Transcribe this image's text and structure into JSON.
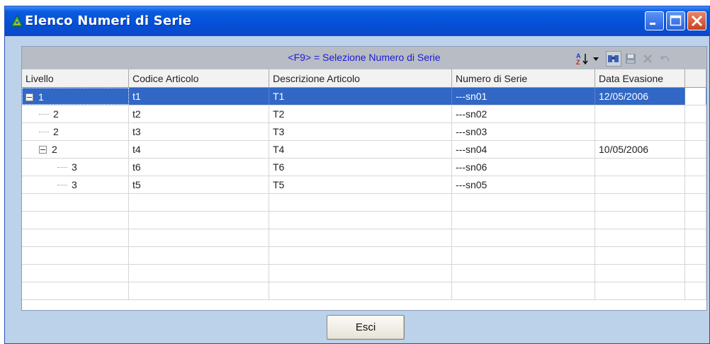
{
  "window": {
    "title": "Elenco Numeri di Serie"
  },
  "grid": {
    "caption": "<F9> = Selezione Numero di Serie",
    "columns": [
      "Livello",
      "Codice Articolo",
      "Descrizione Articolo",
      "Numero di Serie",
      "Data Evasione"
    ],
    "rows": [
      {
        "level": "1",
        "depth": 0,
        "expander": true,
        "codice": "t1",
        "descrizione": "T1",
        "numero": "---sn01",
        "data": "12/05/2006",
        "selected": true
      },
      {
        "level": "2",
        "depth": 1,
        "expander": false,
        "codice": "t2",
        "descrizione": "T2",
        "numero": "---sn02",
        "data": ""
      },
      {
        "level": "2",
        "depth": 1,
        "expander": false,
        "codice": "t3",
        "descrizione": "T3",
        "numero": "---sn03",
        "data": ""
      },
      {
        "level": "2",
        "depth": 1,
        "expander": true,
        "codice": "t4",
        "descrizione": "T4",
        "numero": "---sn04",
        "data": "10/05/2006"
      },
      {
        "level": "3",
        "depth": 2,
        "expander": false,
        "codice": "t6",
        "descrizione": "T6",
        "numero": "---sn06",
        "data": ""
      },
      {
        "level": "3",
        "depth": 2,
        "expander": false,
        "codice": "t5",
        "descrizione": "T5",
        "numero": "---sn05",
        "data": ""
      }
    ],
    "empty_rows": 6
  },
  "toolbar": {
    "icons": [
      "sort-az-icon",
      "dropdown-arrow-icon",
      "find-icon",
      "save-icon",
      "delete-icon",
      "undo-icon"
    ]
  },
  "buttons": {
    "exit_label": "Esci"
  },
  "colors": {
    "selection": "#3167c5",
    "caption_text": "#1a1ad8",
    "titlebar": "#0450d8"
  }
}
